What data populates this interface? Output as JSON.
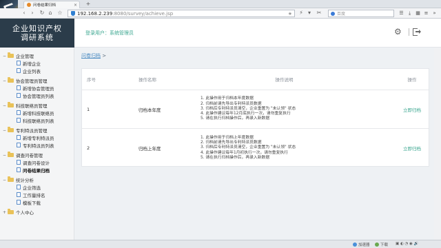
{
  "browser": {
    "tab_title": "问卷结果归档",
    "new_tab": "+",
    "url_host": "192.168.2.239",
    "url_path": ":8080/survey/achieve.jsp",
    "search_placeholder": "百度"
  },
  "brand": {
    "line1": "企业知识产权",
    "line2": "调研系统"
  },
  "header": {
    "login_info": "登录用户：系统管理员"
  },
  "sidebar": {
    "groups": [
      {
        "label": "企业管理",
        "items": [
          "新增企业",
          "企业列表"
        ]
      },
      {
        "label": "协会管理员管理",
        "items": [
          "新增协会管理员",
          "协会管理员列表"
        ]
      },
      {
        "label": "科技联络员管理",
        "items": [
          "新增科技联络员",
          "科技联络员列表"
        ]
      },
      {
        "label": "专利特派员管理",
        "items": [
          "新增专利特派员",
          "专利特派员列表"
        ]
      },
      {
        "label": "调查问卷管理",
        "items": [
          "调查问卷设计",
          "问卷结果归档"
        ]
      },
      {
        "label": "统计分析",
        "items": [
          "企业筛选",
          "工作量排名",
          "模板下载"
        ]
      },
      {
        "label": "个人中心",
        "items": []
      }
    ]
  },
  "breadcrumb": {
    "link": "问卷归档",
    "sep": ">"
  },
  "table": {
    "headers": {
      "no": "序号",
      "name": "操作名称",
      "desc": "操作说明",
      "op": "操作"
    },
    "rows": [
      {
        "no": "1",
        "name": "归档本年度",
        "desc": [
          "1.  此操作用于归档本年度数据",
          "2.  归档前请先导出专利特派员数据",
          "3.  归档后专利特派员清空，企业重置为 \"未认领\" 状态",
          "4.  此操作建议每年12月底执行一次，请勿重复执行",
          "5.  请在执行归档操作后，再录入新数据"
        ],
        "op": "立即归档"
      },
      {
        "no": "2",
        "name": "归档上年度",
        "desc": [
          "1.  此操作用于归档上年度数据",
          "2.  归档前请先导出专利特派员数据",
          "3.  归档后专利特派员清空，企业重置为 \"未认领\" 状态",
          "4.  此操作建议每年1月初执行一次，请勿重复执行",
          "5.  请在执行归档操作后，再录入新数据"
        ],
        "op": "立即归档"
      }
    ]
  },
  "statusbar": {
    "accelerator": "加速器",
    "download": "下载"
  }
}
